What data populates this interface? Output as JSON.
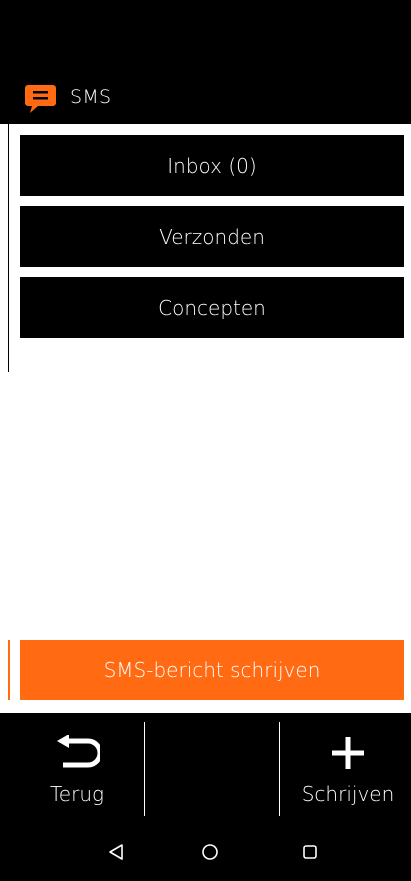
{
  "app": {
    "title": "SMS",
    "icon": "message-bubble-icon",
    "accent_color": "#ff6a13"
  },
  "menu": {
    "items": [
      {
        "label": "Inbox (0)"
      },
      {
        "label": "Verzonden"
      },
      {
        "label": "Concepten"
      }
    ]
  },
  "compose": {
    "label": "SMS-bericht schrijven"
  },
  "action_bar": {
    "back_label": "Terug",
    "back_icon": "return-arrow-icon",
    "write_label": "Schrijven",
    "write_icon": "plus-icon"
  },
  "nav": {
    "back_icon": "triangle-back-icon",
    "home_icon": "circle-home-icon",
    "recents_icon": "square-recents-icon"
  }
}
